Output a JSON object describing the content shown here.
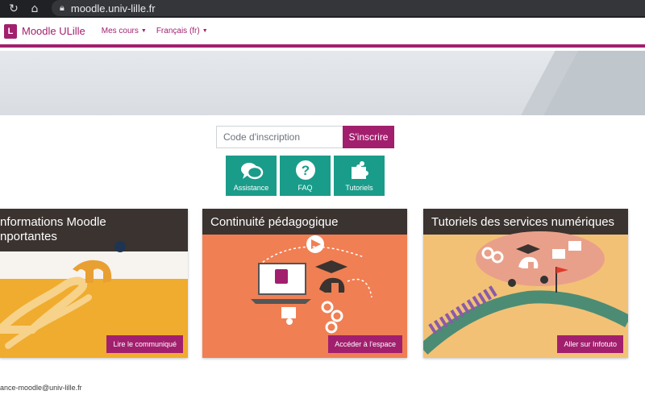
{
  "browser": {
    "url": "moodle.univ-lille.fr"
  },
  "navbar": {
    "logo_letter": "L",
    "site_name": "Moodle ULille",
    "menu_courses": "Mes cours",
    "menu_language": "Français (fr)"
  },
  "enrol": {
    "placeholder": "Code d'inscription",
    "button": "S'inscrire"
  },
  "quick_links": [
    {
      "label": "Assistance",
      "icon": "chat-bubbles-icon"
    },
    {
      "label": "FAQ",
      "icon": "question-icon"
    },
    {
      "label": "Tutoriels",
      "icon": "puzzle-icon"
    }
  ],
  "cards": [
    {
      "title_line1": "nformations Moodle",
      "title_line2": "nportantes",
      "button": "Lire le communiqué"
    },
    {
      "title": "Continuité pédagogique",
      "button": "Accéder à l'espace"
    },
    {
      "title": "Tutoriels des services numériques",
      "button": "Aller sur Infotuto"
    }
  ],
  "footer": {
    "email": "ance-moodle@univ-lille.fr"
  },
  "colors": {
    "brand": "#a21f6e",
    "teal": "#1a9c8a"
  }
}
